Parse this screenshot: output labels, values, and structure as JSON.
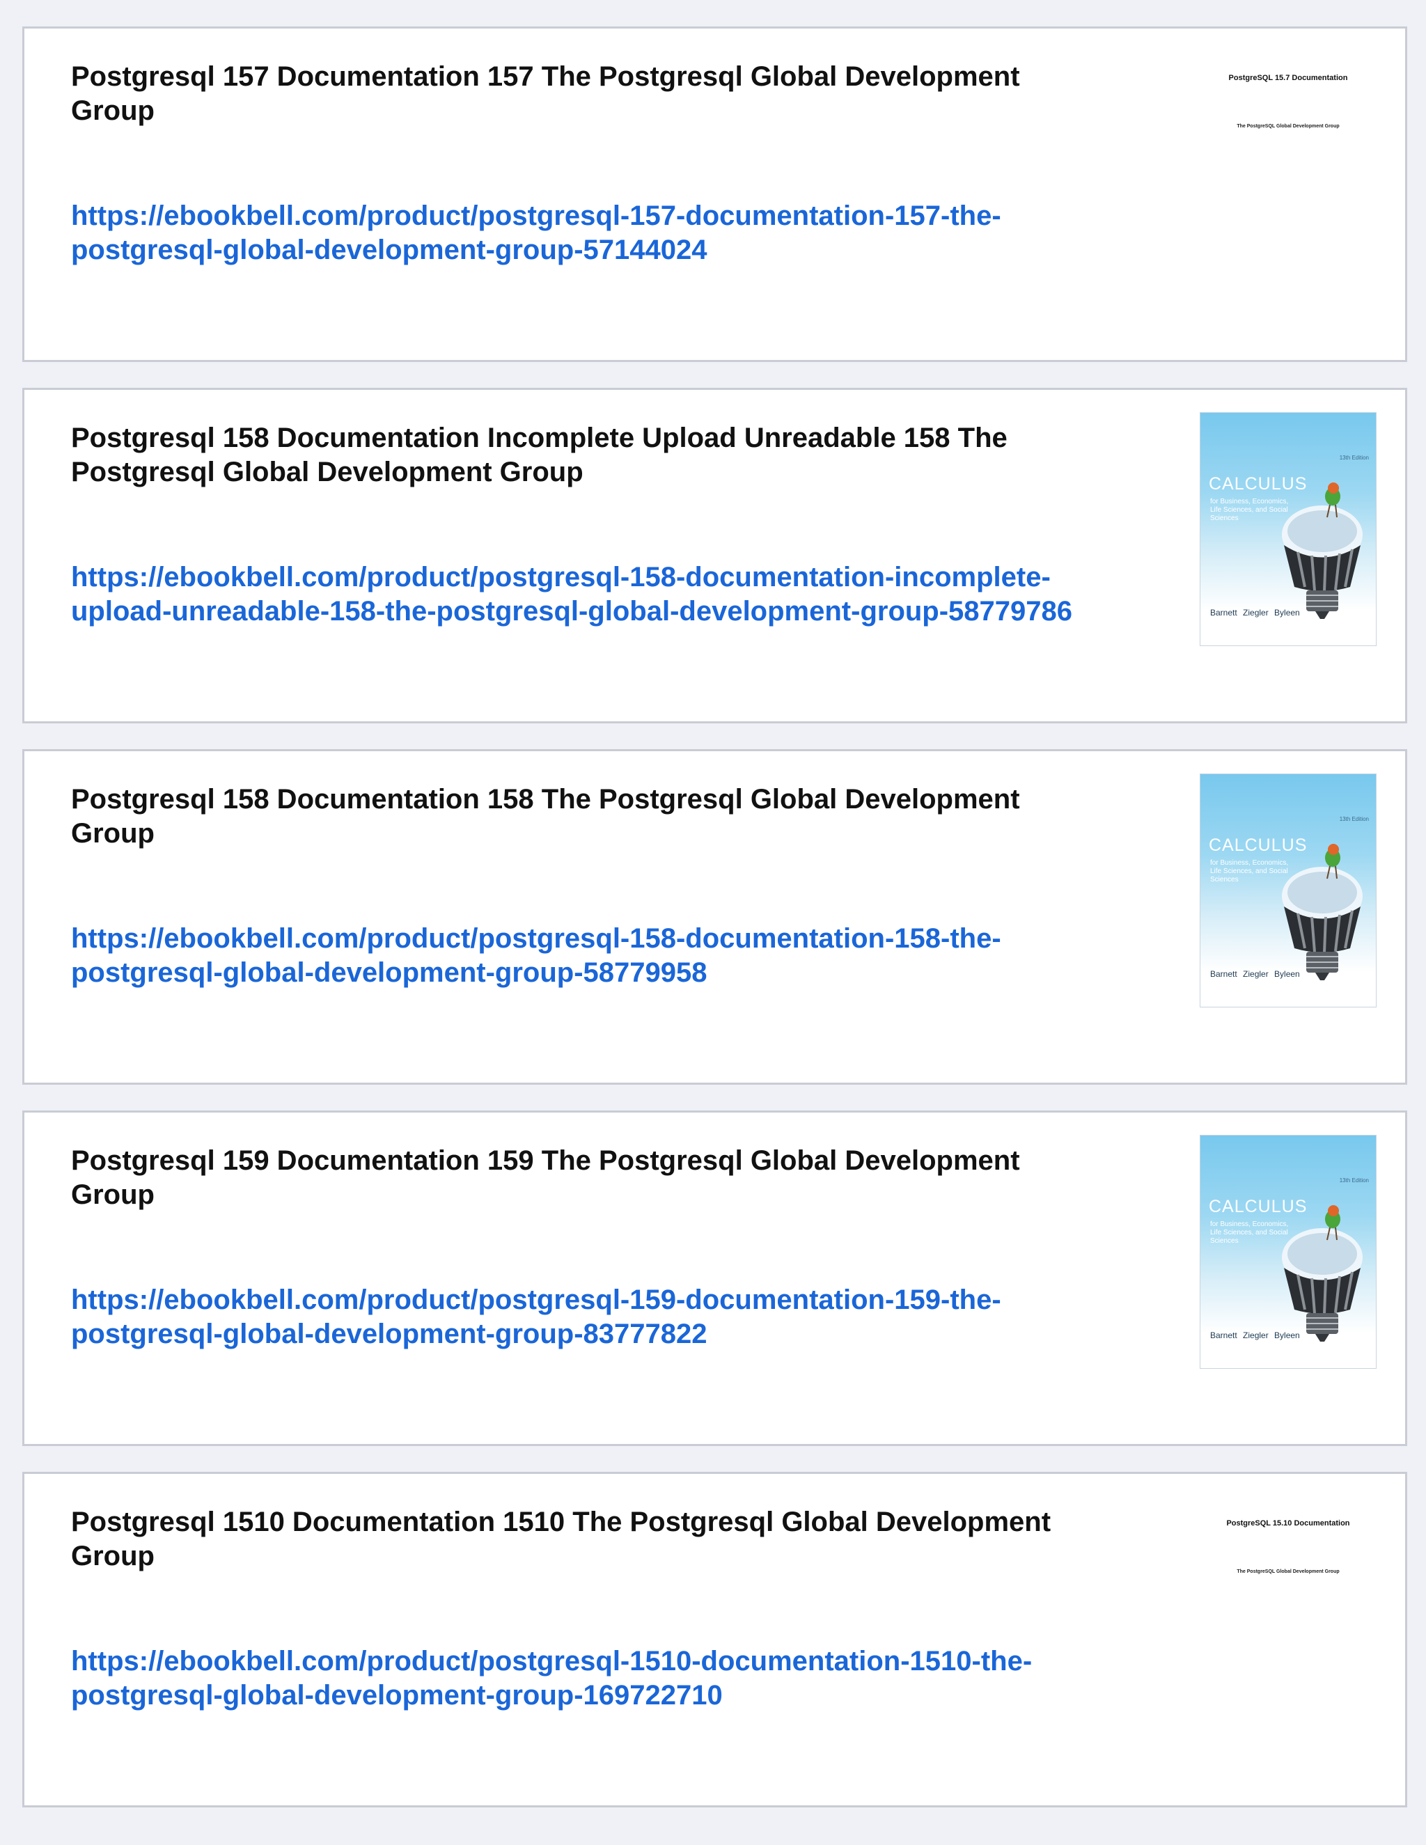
{
  "results": [
    {
      "title": "Postgresql 157 Documentation 157 The Postgresql Global Development Group",
      "url": "https://ebookbell.com/product/postgresql-157-documentation-157-the-postgresql-global-development-group-57144024",
      "thumb": {
        "kind": "doc",
        "title": "PostgreSQL 15.7 Documentation",
        "subtitle": "The PostgreSQL Global Development Group"
      }
    },
    {
      "title": "Postgresql 158 Documentation Incomplete Upload Unreadable 158 The Postgresql Global Development Group",
      "url": "https://ebookbell.com/product/postgresql-158-documentation-incomplete-upload-unreadable-158-the-postgresql-global-development-group-58779786",
      "thumb": {
        "kind": "book",
        "edition": "13th Edition",
        "title": "CALCULUS",
        "subtitle": "for Business, Economics, Life Sciences, and Social Sciences",
        "authors": "Barnett Ziegler Byleen"
      }
    },
    {
      "title": "Postgresql 158 Documentation 158 The Postgresql Global Development Group",
      "url": "https://ebookbell.com/product/postgresql-158-documentation-158-the-postgresql-global-development-group-58779958",
      "thumb": {
        "kind": "book",
        "edition": "13th Edition",
        "title": "CALCULUS",
        "subtitle": "for Business, Economics, Life Sciences, and Social Sciences",
        "authors": "Barnett Ziegler Byleen"
      }
    },
    {
      "title": "Postgresql 159 Documentation 159 The Postgresql Global Development Group",
      "url": "https://ebookbell.com/product/postgresql-159-documentation-159-the-postgresql-global-development-group-83777822",
      "thumb": {
        "kind": "book",
        "edition": "13th Edition",
        "title": "CALCULUS",
        "subtitle": "for Business, Economics, Life Sciences, and Social Sciences",
        "authors": "Barnett Ziegler Byleen"
      }
    },
    {
      "title": "Postgresql 1510 Documentation 1510 The Postgresql Global Development Group",
      "url": "https://ebookbell.com/product/postgresql-1510-documentation-1510-the-postgresql-global-development-group-169722710",
      "thumb": {
        "kind": "doc",
        "title": "PostgreSQL 15.10 Documentation",
        "subtitle": "The PostgreSQL Global Development Group"
      }
    }
  ],
  "colors": {
    "link": "#1a66d8",
    "title": "#111111",
    "page_bg": "#eff1f6",
    "card_border": "#c9ccd4"
  }
}
